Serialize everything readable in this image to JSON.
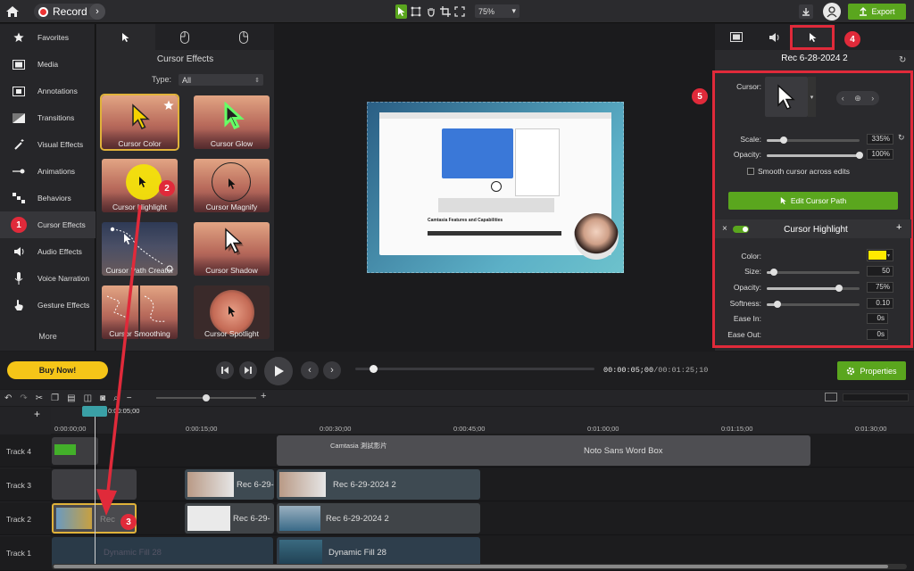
{
  "topbar": {
    "record_label": "Record",
    "zoom": "75%",
    "export_label": "Export"
  },
  "sidebar": {
    "items": [
      {
        "label": "Favorites",
        "icon": "star-icon"
      },
      {
        "label": "Media",
        "icon": "film-icon"
      },
      {
        "label": "Annotations",
        "icon": "annotation-icon"
      },
      {
        "label": "Transitions",
        "icon": "transition-icon"
      },
      {
        "label": "Visual Effects",
        "icon": "magic-wand-icon"
      },
      {
        "label": "Animations",
        "icon": "animation-icon"
      },
      {
        "label": "Behaviors",
        "icon": "behaviors-icon"
      },
      {
        "label": "Cursor Effects",
        "icon": "cursor-icon"
      },
      {
        "label": "Audio Effects",
        "icon": "speaker-icon"
      },
      {
        "label": "Voice Narration",
        "icon": "microphone-icon"
      },
      {
        "label": "Gesture Effects",
        "icon": "hand-icon"
      }
    ],
    "more": "More"
  },
  "effects": {
    "title": "Cursor Effects",
    "type_label": "Type:",
    "type_value": "All",
    "thumbs": [
      "Cursor Color",
      "Cursor Glow",
      "Cursor Highlight",
      "Cursor Magnify",
      "Cursor Path Creator",
      "Cursor Shadow",
      "Cursor Smoothing",
      "Cursor Spotlight"
    ]
  },
  "annotations": {
    "b1": "1",
    "b2": "2",
    "b3": "3",
    "b4": "4",
    "b5": "5"
  },
  "props": {
    "title": "Rec 6-28-2024 2",
    "cursor_label": "Cursor:",
    "scale_label": "Scale:",
    "scale_value": "335%",
    "opacity_label": "Opacity:",
    "opacity_value": "100%",
    "smooth_label": "Smooth cursor across edits",
    "edit_path_label": "Edit Cursor Path",
    "highlight_title": "Cursor Highlight",
    "color_label": "Color:",
    "color_value": "#ffea00",
    "size_label": "Size:",
    "size_value": "50",
    "h_opacity_label": "Opacity:",
    "h_opacity_value": "75%",
    "softness_label": "Softness:",
    "softness_value": "0.10",
    "ease_in_label": "Ease In:",
    "ease_in_value": "0s",
    "ease_out_label": "Ease Out:",
    "ease_out_value": "0s"
  },
  "playback": {
    "buy_now": "Buy Now!",
    "timecode_current": "00:00:05;00",
    "timecode_total": "00:01:25;10",
    "properties_label": "Properties"
  },
  "timeline": {
    "playhead": "0:00:05;00",
    "ruler": [
      "0:00:00;00",
      "0:00:15;00",
      "0:00:30;00",
      "0:00:45;00",
      "0:01:00;00",
      "0:01:15;00",
      "0:01:30;00"
    ],
    "tracks": [
      "Track 4",
      "Track 3",
      "Track 2",
      "Track 1"
    ],
    "clips": {
      "t4_a": "Camtasia 測試影片",
      "t4_b": "Noto Sans Word Box",
      "t3_a": "Rec 6-29-",
      "t3_b": "Rec 6-29-2024 2",
      "t2_a": "Rec",
      "t2_b": "Rec 6-29-",
      "t2_c": "Rec 6-29-2024 2",
      "t1_a": "Dynamic Fill 28",
      "t1_b": "Dynamic Fill 28"
    }
  },
  "preview": {
    "article_title": "Camtasia Features and Capabilities"
  }
}
